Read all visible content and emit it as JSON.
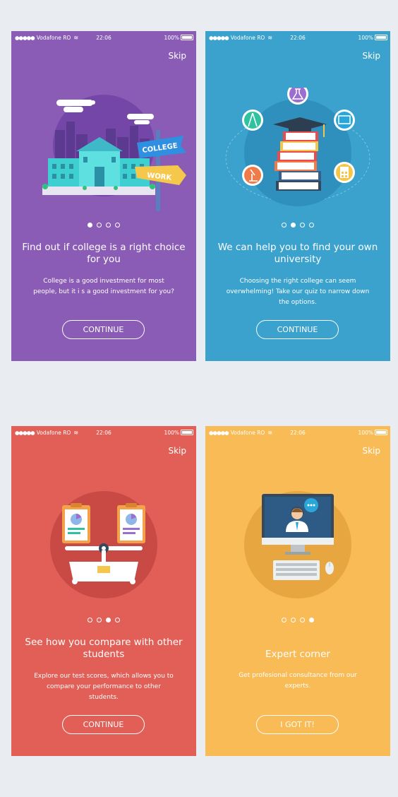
{
  "status_bar": {
    "signal": "●●●●●",
    "carrier": "Vodafone RO",
    "time": "22:06",
    "battery": "100%"
  },
  "screens": [
    {
      "skip": "Skip",
      "illustration": "college-campus-illustration",
      "sign_labels": [
        "COLLEGE",
        "WORK"
      ],
      "page_indicator": {
        "total": 4,
        "active": 1
      },
      "title": "Find out if college is a right choice for you",
      "description": "College is a  good investment for most people, but it i s a good investment for you?",
      "button": "CONTINUE",
      "color": "#8a5cb5"
    },
    {
      "skip": "Skip",
      "illustration": "books-graduation-illustration",
      "page_indicator": {
        "total": 4,
        "active": 2
      },
      "title": "We can help you to find your own university",
      "description": "Choosing  the right college can seem overwhelming! Take our quiz to narrow down the options.",
      "button": "CONTINUE",
      "color": "#3aa2cc"
    },
    {
      "skip": "Skip",
      "illustration": "balance-scale-illustration",
      "page_indicator": {
        "total": 4,
        "active": 3
      },
      "title": "See how you compare with other students",
      "description": "Explore our test scores, which allows you to compare your performance to other students.",
      "button": "CONTINUE",
      "color": "#e25f57"
    },
    {
      "skip": "Skip",
      "illustration": "computer-consultant-illustration",
      "page_indicator": {
        "total": 4,
        "active": 4
      },
      "title": "Expert corner",
      "description": "Get profesional consultance from our experts.",
      "button": "I GOT IT!",
      "color": "#f8bb55"
    }
  ]
}
